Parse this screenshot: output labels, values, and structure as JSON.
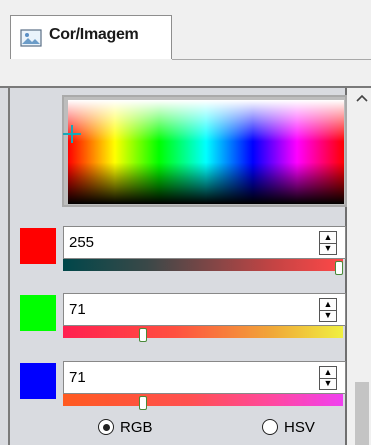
{
  "tab": {
    "label": "Cor/Imagem",
    "icon": "image-icon"
  },
  "colors": {
    "panel_bg": "#d9dbe0",
    "crosshair": "#18a8b8",
    "slider_thumb_border": "#4a8a3a"
  },
  "channels": [
    {
      "name": "red",
      "value": "255",
      "swatch": "#ff0000",
      "fraction": 1.0
    },
    {
      "name": "green",
      "value": "71",
      "swatch": "#00ff00",
      "fraction": 0.278
    },
    {
      "name": "blue",
      "value": "71",
      "swatch": "#0000ff",
      "fraction": 0.278
    }
  ],
  "mode": {
    "options": [
      {
        "label": "RGB",
        "selected": true
      },
      {
        "label": "HSV",
        "selected": false
      }
    ]
  }
}
